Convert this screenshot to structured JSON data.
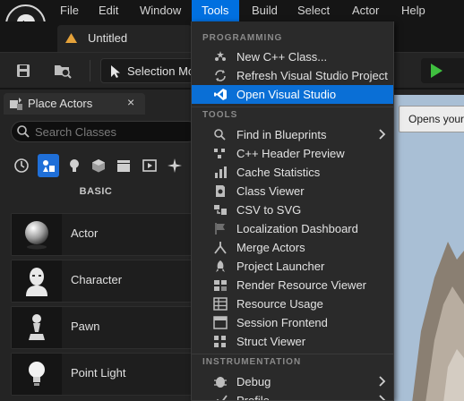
{
  "menubar": {
    "items": [
      {
        "label": "File"
      },
      {
        "label": "Edit"
      },
      {
        "label": "Window"
      },
      {
        "label": "Tools"
      },
      {
        "label": "Build"
      },
      {
        "label": "Select"
      },
      {
        "label": "Actor"
      },
      {
        "label": "Help"
      }
    ],
    "active": "Tools"
  },
  "tabs": {
    "document_title": "Untitled"
  },
  "toolbar": {
    "mode_label": "Selection Mo"
  },
  "place_actors": {
    "panel_title": "Place Actors",
    "close_glyph": "×",
    "search_placeholder": "Search Classes",
    "section_header": "BASIC",
    "actors": [
      {
        "label": "Actor",
        "icon": "sphere-icon"
      },
      {
        "label": "Character",
        "icon": "character-icon"
      },
      {
        "label": "Pawn",
        "icon": "pawn-icon"
      },
      {
        "label": "Point Light",
        "icon": "lightbulb-icon"
      }
    ]
  },
  "tooltip": {
    "text": "Opens your"
  },
  "tools_menu": {
    "sections": {
      "programming": "PROGRAMMING",
      "tools": "TOOLS",
      "instrumentation": "INSTRUMENTATION"
    },
    "programming_items": [
      {
        "label": "New C++ Class...",
        "icon": "new-cpp-class-icon"
      },
      {
        "label": "Refresh Visual Studio Project",
        "icon": "refresh-icon"
      },
      {
        "label": "Open Visual Studio",
        "icon": "visual-studio-icon"
      }
    ],
    "tools_items": [
      {
        "label": "Find in Blueprints",
        "icon": "find-icon"
      },
      {
        "label": "C++ Header Preview",
        "icon": "header-preview-icon"
      },
      {
        "label": "Cache Statistics",
        "icon": "statistics-icon"
      },
      {
        "label": "Class Viewer",
        "icon": "class-viewer-icon"
      },
      {
        "label": "CSV to SVG",
        "icon": "csv-icon"
      },
      {
        "label": "Localization Dashboard",
        "icon": "flag-icon"
      },
      {
        "label": "Merge Actors",
        "icon": "merge-icon"
      },
      {
        "label": "Project Launcher",
        "icon": "launcher-icon"
      },
      {
        "label": "Render Resource Viewer",
        "icon": "render-icon"
      },
      {
        "label": "Resource Usage",
        "icon": "resource-icon"
      },
      {
        "label": "Session Frontend",
        "icon": "session-icon"
      },
      {
        "label": "Struct Viewer",
        "icon": "struct-icon"
      }
    ],
    "instrumentation_items": [
      {
        "label": "Debug",
        "icon": "debug-icon"
      },
      {
        "label": "Profile",
        "icon": "profile-icon"
      }
    ],
    "highlighted": "Open Visual Studio"
  },
  "colors": {
    "accent": "#0070e0",
    "menu_bg": "#2a2a2a",
    "panel_bg": "#242424",
    "play_green": "#3fbf3f"
  }
}
